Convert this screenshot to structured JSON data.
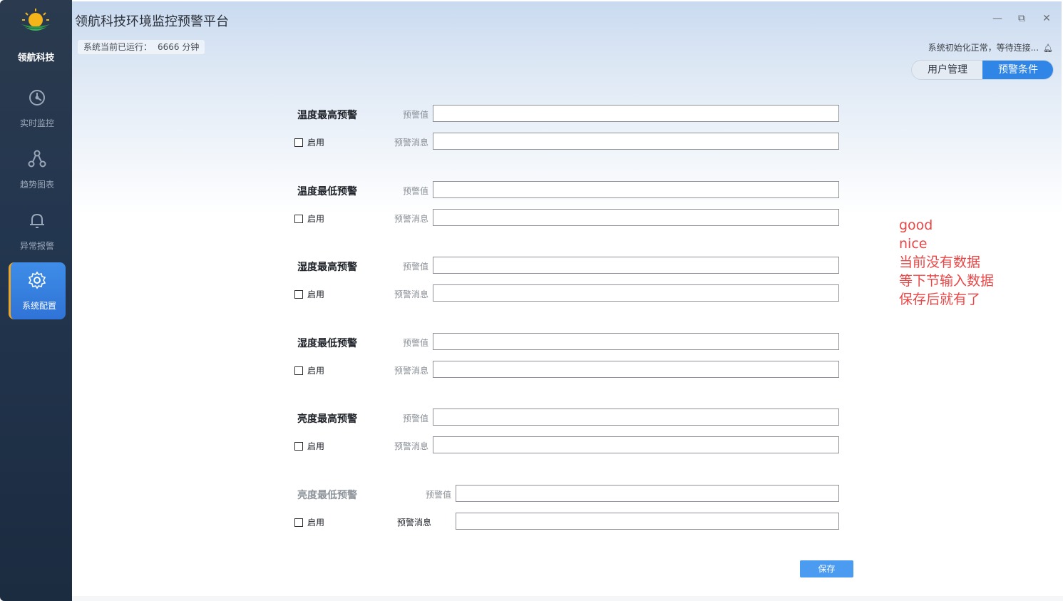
{
  "sidebar": {
    "brand": "领航科技",
    "items": [
      {
        "label": "实时监控",
        "icon": "dashboard-icon"
      },
      {
        "label": "趋势图表",
        "icon": "chart-nodes-icon"
      },
      {
        "label": "异常报警",
        "icon": "bell-icon"
      },
      {
        "label": "系统配置",
        "icon": "gear-icon",
        "active": true
      }
    ]
  },
  "window": {
    "title": "领航科技环境监控预警平台",
    "minimize": "—",
    "restore": "⧉",
    "close": "✕"
  },
  "statusbar": {
    "runtime_label": "系统当前已运行：",
    "runtime_value": "6666 分钟",
    "status_text": "系统初始化正常，等待连接..."
  },
  "tabs": [
    {
      "label": "用户管理",
      "active": false
    },
    {
      "label": "预警条件",
      "active": true
    }
  ],
  "form": {
    "groups": [
      {
        "title": "温度最高预警",
        "enable_label": "启用",
        "value_label": "预警值",
        "message_label": "预警消息",
        "value": "",
        "message": ""
      },
      {
        "title": "温度最低预警",
        "enable_label": "启用",
        "value_label": "预警值",
        "message_label": "预警消息",
        "value": "",
        "message": ""
      },
      {
        "title": "湿度最高预警",
        "enable_label": "启用",
        "value_label": "预警值",
        "message_label": "预警消息",
        "value": "",
        "message": ""
      },
      {
        "title": "湿度最低预警",
        "enable_label": "启用",
        "value_label": "预警值",
        "message_label": "预警消息",
        "value": "",
        "message": ""
      },
      {
        "title": "亮度最高预警",
        "enable_label": "启用",
        "value_label": "预警值",
        "message_label": "预警消息",
        "value": "",
        "message": ""
      },
      {
        "title": "亮度最低预警",
        "enable_label": "启用",
        "value_label": "预警值",
        "message_label": "预警消息",
        "value": "",
        "message": ""
      }
    ],
    "save_label": "保存"
  },
  "annotation": {
    "lines": [
      "good",
      "nice",
      "当前没有数据",
      "等下节输入数据",
      "保存后就有了"
    ],
    "color": "#e84646"
  },
  "colors": {
    "accent": "#2f86e6",
    "sidebar_bg": "#23364f",
    "active_marker": "#f0a623"
  }
}
